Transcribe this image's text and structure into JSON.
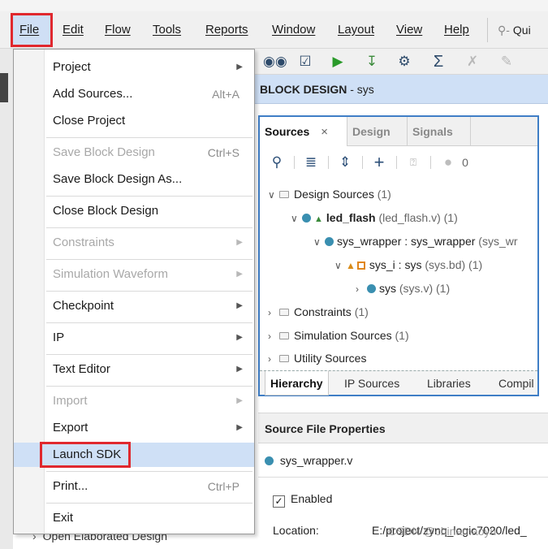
{
  "menubar": {
    "items": [
      {
        "id": "file",
        "label": "File"
      },
      {
        "id": "edit",
        "label": "Edit"
      },
      {
        "id": "flow",
        "label": "Flow"
      },
      {
        "id": "tools",
        "label": "Tools"
      },
      {
        "id": "reports",
        "label": "Reports"
      },
      {
        "id": "window",
        "label": "Window"
      },
      {
        "id": "layout",
        "label": "Layout"
      },
      {
        "id": "view",
        "label": "View"
      },
      {
        "id": "help",
        "label": "Help"
      }
    ],
    "search_placeholder": "Qui"
  },
  "file_menu": {
    "items": [
      {
        "label": "Project",
        "shortcut": "",
        "submenu": true,
        "disabled": false
      },
      {
        "label": "Add Sources...",
        "shortcut": "Alt+A",
        "submenu": false,
        "disabled": false
      },
      {
        "label": "Close Project",
        "shortcut": "",
        "submenu": false,
        "disabled": false
      },
      {
        "label": "Save Block Design",
        "shortcut": "Ctrl+S",
        "submenu": false,
        "disabled": true
      },
      {
        "label": "Save Block Design As...",
        "shortcut": "",
        "submenu": false,
        "disabled": false
      },
      {
        "label": "Close Block Design",
        "shortcut": "",
        "submenu": false,
        "disabled": false
      },
      {
        "label": "Constraints",
        "shortcut": "",
        "submenu": true,
        "disabled": true
      },
      {
        "label": "Simulation Waveform",
        "shortcut": "",
        "submenu": true,
        "disabled": true
      },
      {
        "label": "Checkpoint",
        "shortcut": "",
        "submenu": true,
        "disabled": false
      },
      {
        "label": "IP",
        "shortcut": "",
        "submenu": true,
        "disabled": false
      },
      {
        "label": "Text Editor",
        "shortcut": "",
        "submenu": true,
        "disabled": false
      },
      {
        "label": "Import",
        "shortcut": "",
        "submenu": true,
        "disabled": true
      },
      {
        "label": "Export",
        "shortcut": "",
        "submenu": true,
        "disabled": false
      },
      {
        "label": "Launch SDK",
        "shortcut": "",
        "submenu": false,
        "disabled": false,
        "selected": true
      },
      {
        "label": "Print...",
        "shortcut": "Ctrl+P",
        "submenu": false,
        "disabled": false
      },
      {
        "label": "Exit",
        "shortcut": "",
        "submenu": false,
        "disabled": false
      }
    ]
  },
  "block_design": {
    "title": "BLOCK DESIGN",
    "name": "- sys"
  },
  "sources": {
    "tabs": [
      {
        "label": "Sources",
        "active": true
      },
      {
        "label": "Design",
        "active": false
      },
      {
        "label": "Signals",
        "active": false
      }
    ],
    "count_badge": "0",
    "tree": {
      "design_sources": {
        "label": "Design Sources",
        "count": "(1)"
      },
      "led_flash": {
        "label": "led_flash",
        "detail": "(led_flash.v) (1)"
      },
      "sys_wrapper": {
        "label": "sys_wrapper : sys_wrapper",
        "detail": "(sys_wr"
      },
      "sys_i": {
        "label": "sys_i : sys",
        "detail": "(sys.bd) (1)"
      },
      "sys": {
        "label": "sys",
        "detail": "(sys.v) (1)"
      },
      "constraints": {
        "label": "Constraints",
        "count": "(1)"
      },
      "simulation_sources": {
        "label": "Simulation Sources",
        "count": "(1)"
      },
      "utility_sources": {
        "label": "Utility Sources",
        "count": ""
      }
    },
    "bottom_tabs": [
      {
        "label": "Hierarchy",
        "active": true
      },
      {
        "label": "IP Sources",
        "active": false
      },
      {
        "label": "Libraries",
        "active": false
      },
      {
        "label": "Compil",
        "active": false
      }
    ]
  },
  "properties": {
    "header": "Source File Properties",
    "file": "sys_wrapper.v",
    "enabled_label": "Enabled",
    "location_label": "Location:",
    "location_value": "E:/project/zynq_logic7020/led_"
  },
  "background": {
    "open_elaborated": "Open Elaborated Design"
  },
  "watermark": "CSDN @chinamaoyu"
}
